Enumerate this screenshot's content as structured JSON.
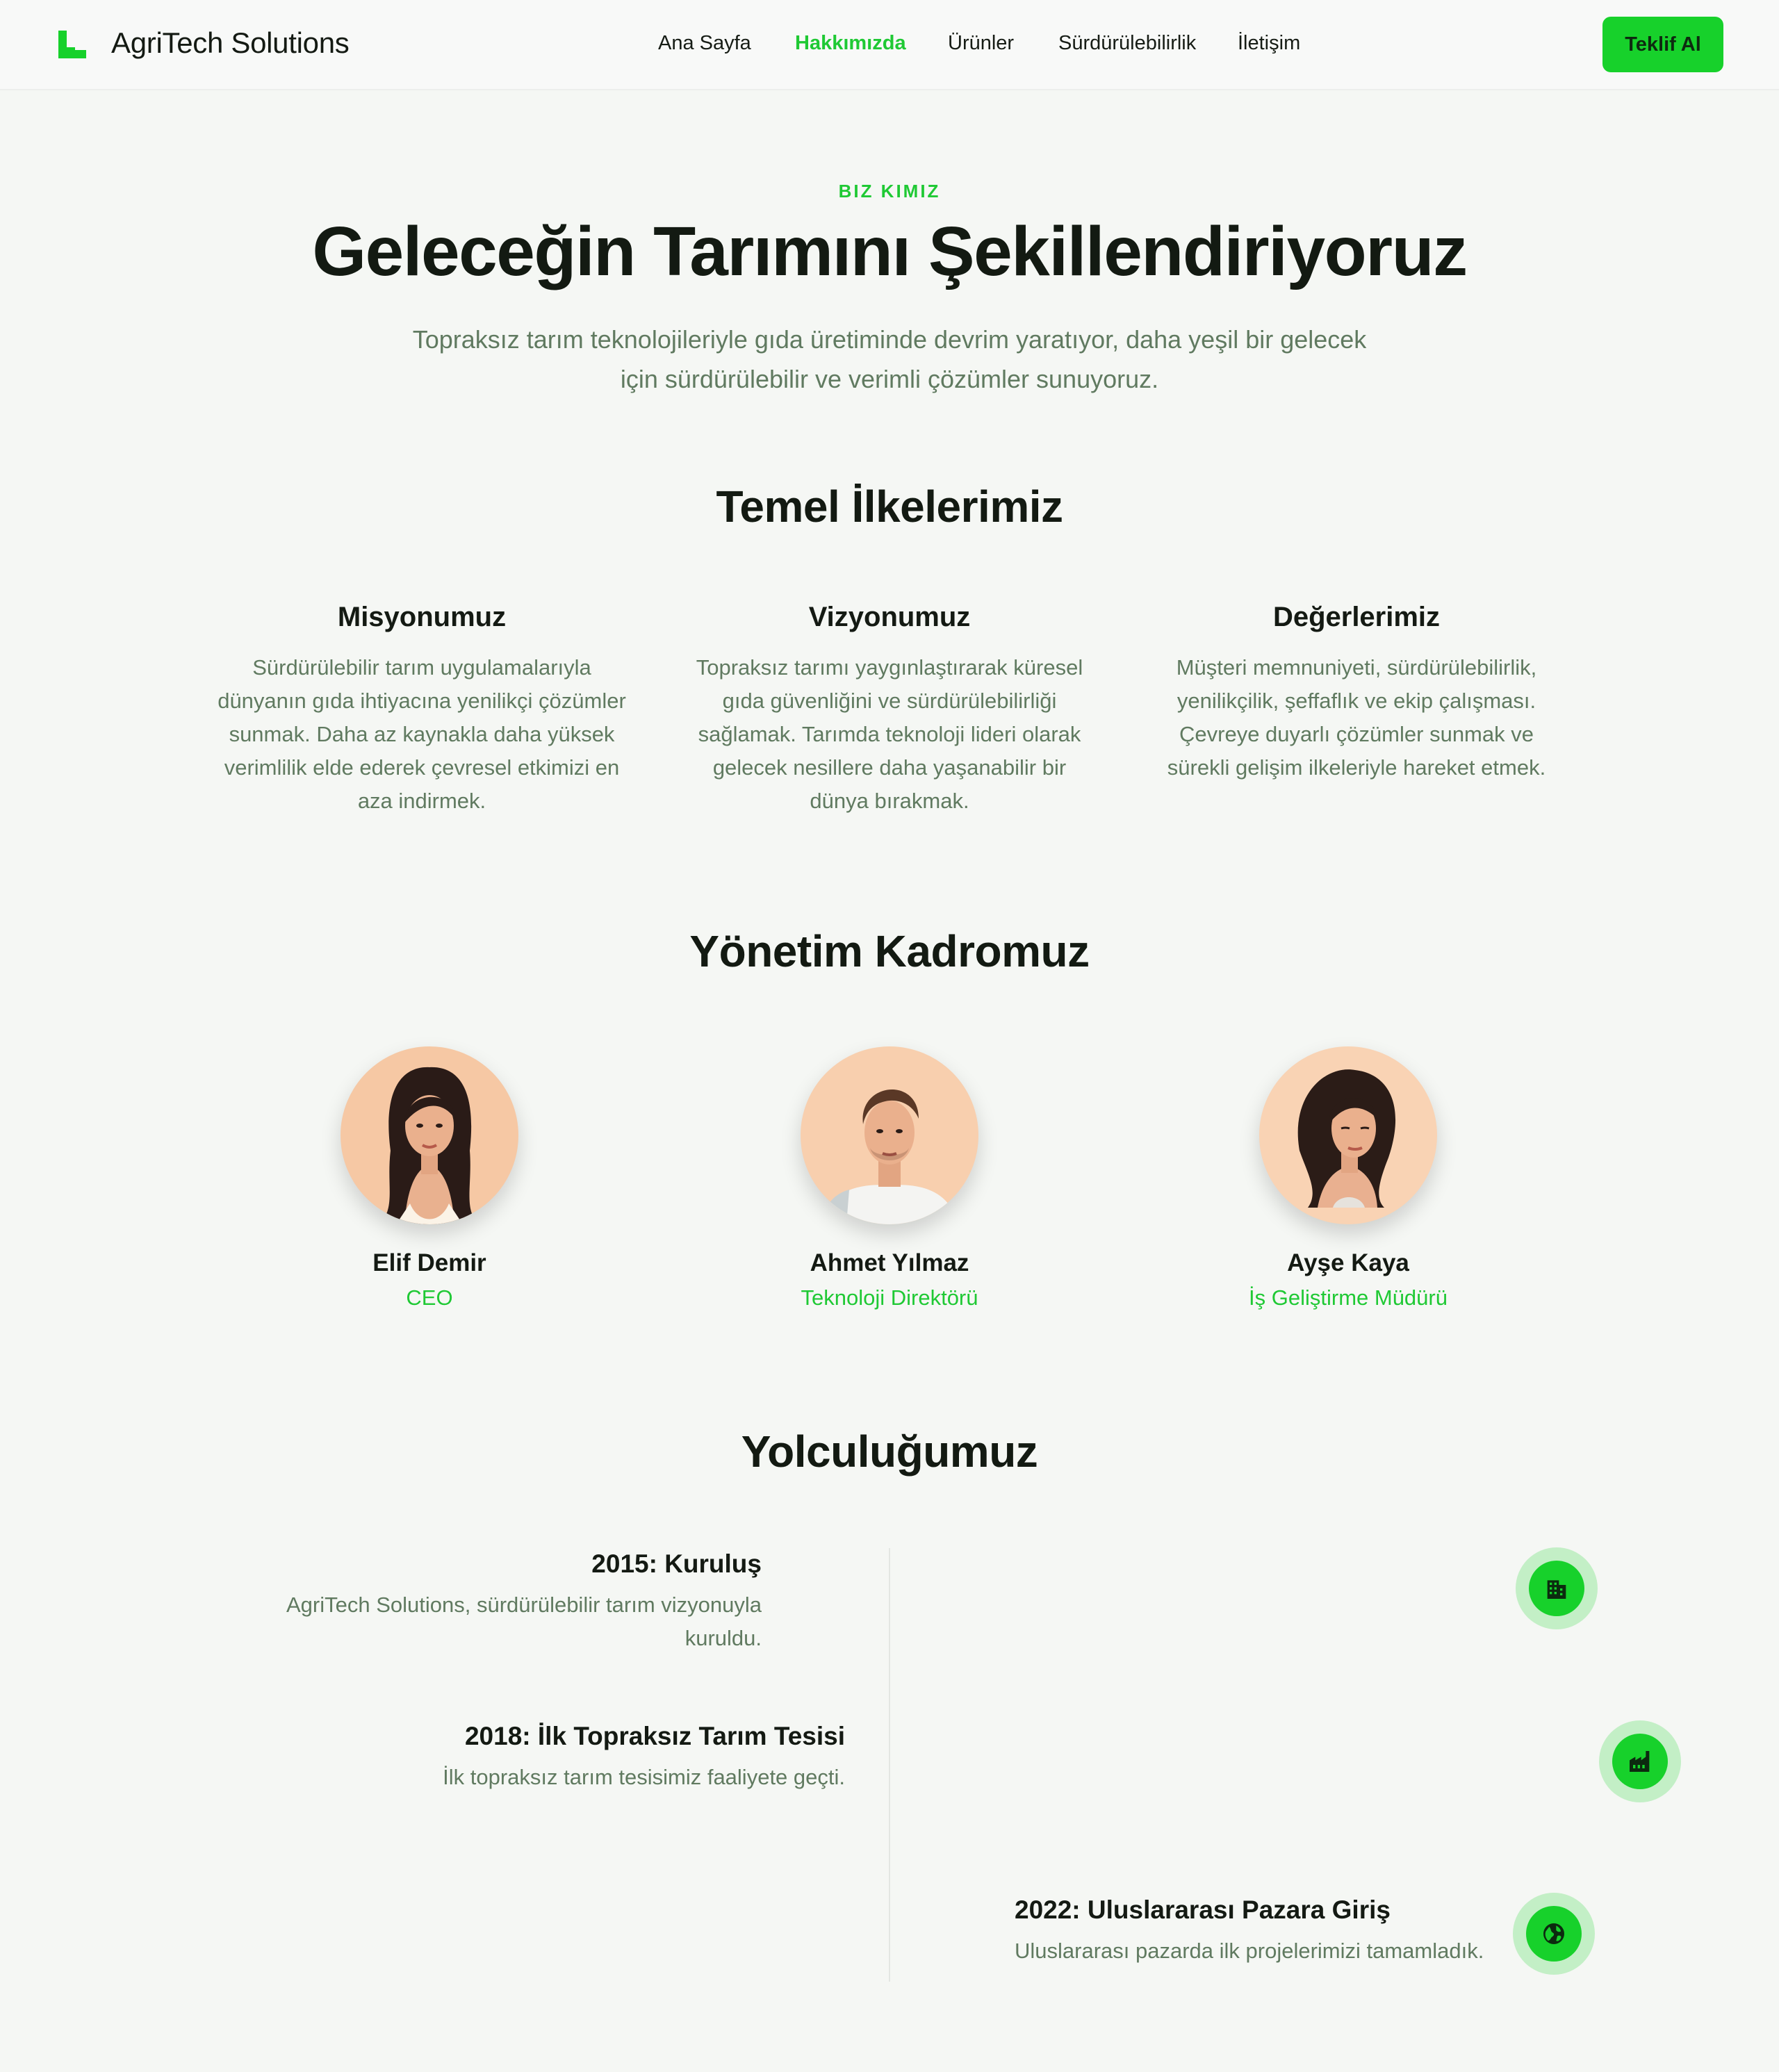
{
  "header": {
    "brand": "AgriTech Solutions",
    "logo_icon": "stairs-logo-icon",
    "nav": [
      {
        "label": "Ana Sayfa",
        "active": false
      },
      {
        "label": "Hakkımızda",
        "active": true
      },
      {
        "label": "Ürünler",
        "active": false
      },
      {
        "label": "Sürdürülebilirlik",
        "active": false
      },
      {
        "label": "İletişim",
        "active": false
      }
    ],
    "cta_label": "Teklif Al"
  },
  "hero": {
    "eyebrow": "BIZ KIMIZ",
    "title": "Geleceğin Tarımını Şekillendiriyoruz",
    "subtitle": "Topraksız tarım teknolojileriyle gıda üretiminde devrim yaratıyor, daha yeşil bir gelecek için sürdürülebilir ve verimli çözümler sunuyoruz."
  },
  "principles": {
    "title": "Temel İlkelerimiz",
    "items": [
      {
        "title": "Misyonumuz",
        "text": "Sürdürülebilir tarım uygulamalarıyla dünyanın gıda ihtiyacına yenilikçi çözümler sunmak. Daha az kaynakla daha yüksek verimlilik elde ederek çevresel etkimizi en aza indirmek."
      },
      {
        "title": "Vizyonumuz",
        "text": "Topraksız tarımı yaygınlaştırarak küresel gıda güvenliğini ve sürdürülebilirliği sağlamak. Tarımda teknoloji lideri olarak gelecek nesillere daha yaşanabilir bir dünya bırakmak."
      },
      {
        "title": "Değerlerimiz",
        "text": "Müşteri memnuniyeti, sürdürülebilirlik, yenilikçilik, şeffaflık ve ekip çalışması. Çevreye duyarlı çözümler sunmak ve sürekli gelişim ilkeleriyle hareket etmek."
      }
    ]
  },
  "team": {
    "title": "Yönetim Kadromuz",
    "members": [
      {
        "name": "Elif Demir",
        "role": "CEO"
      },
      {
        "name": "Ahmet Yılmaz",
        "role": "Teknoloji Direktörü"
      },
      {
        "name": "Ayşe Kaya",
        "role": "İş Geliştirme Müdürü"
      }
    ]
  },
  "journey": {
    "title": "Yolculuğumuz",
    "events": [
      {
        "title": "2015: Kuruluş",
        "text": "AgriTech Solutions, sürdürülebilir tarım vizyonuyla kuruldu.",
        "icon": "office-building-icon"
      },
      {
        "title": "2018: İlk Topraksız Tarım Tesisi",
        "text": "İlk topraksız tarım tesisimiz faaliyete geçti.",
        "icon": "factory-icon"
      },
      {
        "title": "2022: Uluslararası Pazara Giriş",
        "text": "Uluslararası pazarda ilk projelerimizi tamamladık.",
        "icon": "globe-icon"
      }
    ]
  },
  "colors": {
    "accent": "#1fc934",
    "button": "#17d12b",
    "muted_text": "#607a60",
    "background": "#f5f7f4"
  }
}
